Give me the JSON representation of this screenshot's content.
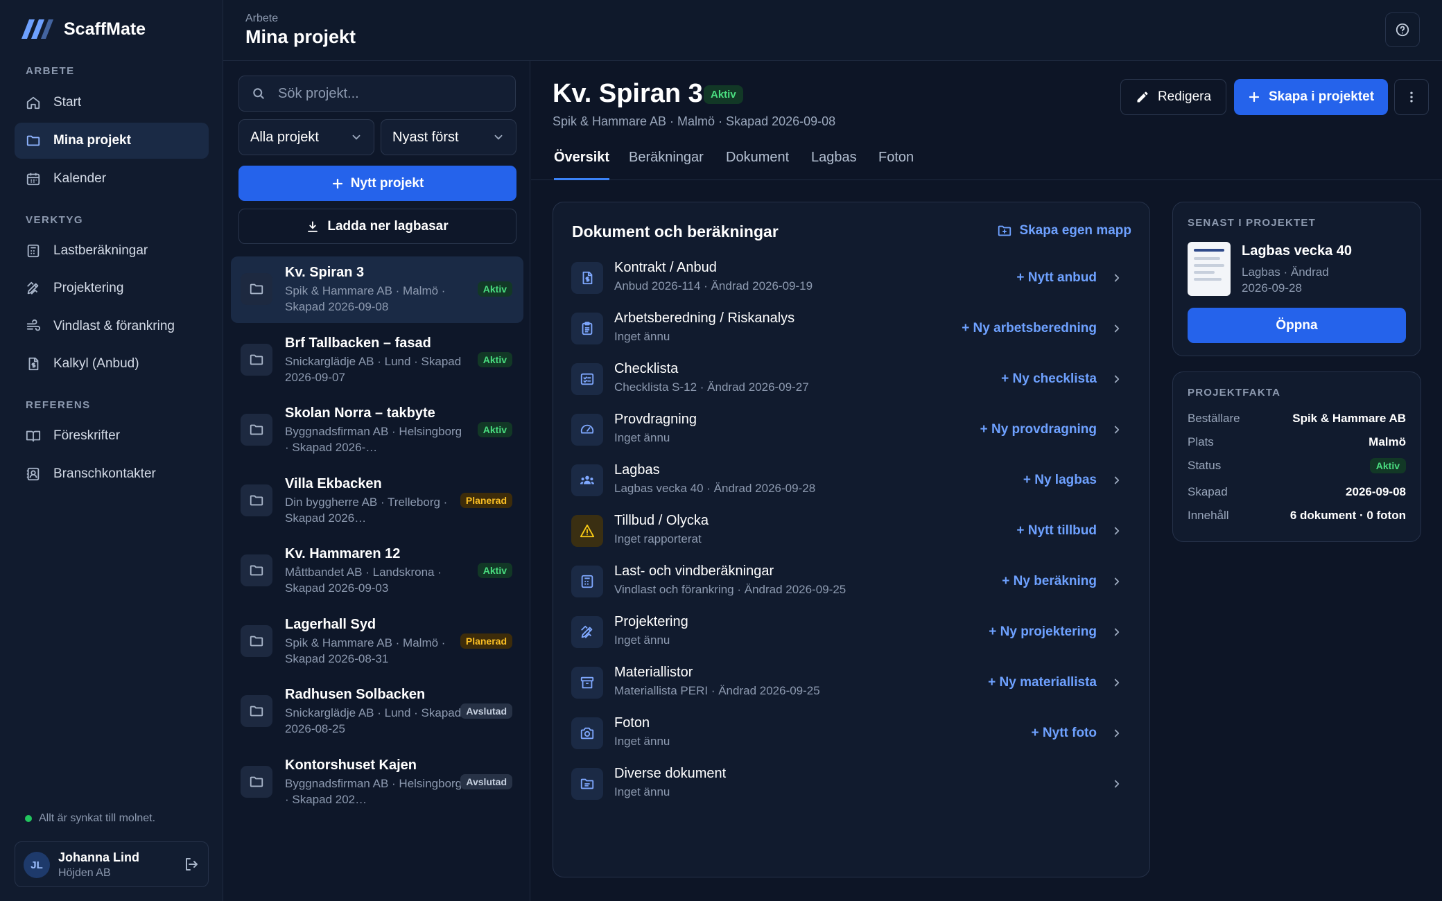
{
  "brand": {
    "name": "ScaffMate",
    "accent": "#3b82f6"
  },
  "nav": {
    "sections": {
      "arbete": "ARBETE",
      "verktyg": "VERKTYG",
      "referens": "REFERENS"
    },
    "items": [
      {
        "label": "Start",
        "icon": "home-icon"
      },
      {
        "label": "Mina projekt",
        "icon": "folder-icon",
        "active": true
      },
      {
        "label": "Kalender",
        "icon": "calendar-icon"
      },
      {
        "label": "Lastberäkningar",
        "icon": "calculator-icon"
      },
      {
        "label": "Projektering",
        "icon": "pencil-ruler-icon"
      },
      {
        "label": "Vindlast & förankring",
        "icon": "wind-icon"
      },
      {
        "label": "Kalkyl (Anbud)",
        "icon": "document-dollar-icon"
      },
      {
        "label": "Föreskrifter",
        "icon": "book-icon"
      },
      {
        "label": "Branschkontakter",
        "icon": "contact-card-icon"
      }
    ],
    "sync_status": "Allt är synkat till molnet.",
    "user": {
      "initials": "JL",
      "name": "Johanna Lind",
      "org": "Höjden AB"
    }
  },
  "header": {
    "breadcrumb": "Arbete",
    "title": "Mina projekt"
  },
  "list": {
    "search_placeholder": "Sök projekt...",
    "filter": "Alla projekt",
    "sort": "Nyast först",
    "new_button": "Nytt projekt",
    "download_button": "Ladda ner lagbasar",
    "projects": [
      {
        "name": "Kv. Spiran 3",
        "meta": "Spik & Hammare AB · Malmö · Skapad 2026-09-08",
        "status": "Aktiv",
        "kind": "aktiv",
        "selected": true
      },
      {
        "name": "Brf Tallbacken – fasad",
        "meta": "Snickarglädje AB · Lund · Skapad 2026-09-07",
        "status": "Aktiv",
        "kind": "aktiv"
      },
      {
        "name": "Skolan Norra – takbyte",
        "meta": "Byggnadsfirman AB · Helsingborg · Skapad 2026-…",
        "status": "Aktiv",
        "kind": "aktiv"
      },
      {
        "name": "Villa Ekbacken",
        "meta": "Din byggherre AB · Trelleborg · Skapad 2026…",
        "status": "Planerad",
        "kind": "planerad"
      },
      {
        "name": "Kv. Hammaren 12",
        "meta": "Måttbandet AB · Landskrona · Skapad 2026-09-03",
        "status": "Aktiv",
        "kind": "aktiv"
      },
      {
        "name": "Lagerhall Syd",
        "meta": "Spik & Hammare AB · Malmö · Skapad 2026-08-31",
        "status": "Planerad",
        "kind": "planerad"
      },
      {
        "name": "Radhusen Solbacken",
        "meta": "Snickarglädje AB · Lund · Skapad 2026-08-25",
        "status": "Avslutad",
        "kind": "avslutad"
      },
      {
        "name": "Kontorshuset Kajen",
        "meta": "Byggnadsfirman AB · Helsingborg · Skapad 202…",
        "status": "Avslutad",
        "kind": "avslutad"
      }
    ]
  },
  "detail": {
    "title": "Kv. Spiran 3",
    "status": "Aktiv",
    "meta": "Spik & Hammare AB · Malmö · Skapad 2026-09-08",
    "edit_button": "Redigera",
    "create_button": "Skapa i projektet",
    "tabs": [
      "Översikt",
      "Beräkningar",
      "Dokument",
      "Lagbas",
      "Foton"
    ],
    "active_tab": "Översikt",
    "docs": {
      "title": "Dokument och beräkningar",
      "create_folder": "Skapa egen mapp",
      "rows": [
        {
          "name": "Kontrakt / Anbud",
          "sub": "Anbud 2026-114 · Ändrad 2026-09-19",
          "action": "+ Nytt anbud",
          "icon": "document-dollar-icon"
        },
        {
          "name": "Arbetsberedning / Riskanalys",
          "sub": "Inget ännu",
          "action": "+ Ny arbetsberedning",
          "icon": "clipboard-icon"
        },
        {
          "name": "Checklista",
          "sub": "Checklista S-12 · Ändrad 2026-09-27",
          "action": "+ Ny checklista",
          "icon": "checklist-icon"
        },
        {
          "name": "Provdragning",
          "sub": "Inget ännu",
          "action": "+ Ny provdragning",
          "icon": "gauge-icon"
        },
        {
          "name": "Lagbas",
          "sub": "Lagbas vecka 40 · Ändrad 2026-09-28",
          "action": "+ Ny lagbas",
          "icon": "team-icon"
        },
        {
          "name": "Tillbud / Olycka",
          "sub": "Inget rapporterat",
          "action": "+ Nytt tillbud",
          "icon": "warning-icon"
        },
        {
          "name": "Last- och vindberäkningar",
          "sub": "Vindlast och förankring · Ändrad 2026-09-25",
          "action": "+ Ny beräkning",
          "icon": "calculator-icon"
        },
        {
          "name": "Projektering",
          "sub": "Inget ännu",
          "action": "+ Ny projektering",
          "icon": "pencil-ruler-icon"
        },
        {
          "name": "Materiallistor",
          "sub": "Materiallista PERI · Ändrad 2026-09-25",
          "action": "+ Ny materiallista",
          "icon": "archive-icon"
        },
        {
          "name": "Foton",
          "sub": "Inget ännu",
          "action": "+ Nytt foto",
          "icon": "camera-icon"
        },
        {
          "name": "Diverse dokument",
          "sub": "Inget ännu",
          "action": "",
          "icon": "folder-doc-icon"
        }
      ]
    },
    "recent": {
      "label": "SENAST I PROJEKTET",
      "name": "Lagbas vecka 40",
      "sub": "Lagbas · Ändrad 2026-09-28",
      "open_button": "Öppna"
    },
    "facts": {
      "label": "PROJEKTFAKTA",
      "rows": [
        {
          "key": "Beställare",
          "value": "Spik & Hammare AB"
        },
        {
          "key": "Plats",
          "value": "Malmö"
        },
        {
          "key": "Status",
          "value": "Aktiv",
          "badge": true
        },
        {
          "key": "Skapad",
          "value": "2026-09-08"
        },
        {
          "key": "Innehåll",
          "value": "6 dokument · 0 foton"
        }
      ]
    }
  }
}
